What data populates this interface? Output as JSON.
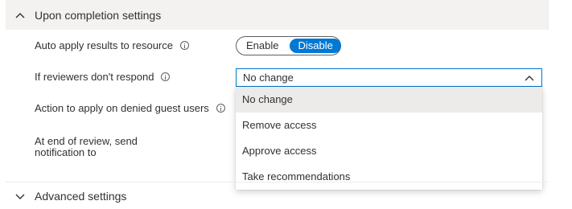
{
  "completion_section": {
    "title": "Upon completion settings",
    "expanded": true
  },
  "auto_apply": {
    "label": "Auto apply results to resource",
    "options": [
      "Enable",
      "Disable"
    ],
    "selected": "Disable"
  },
  "no_response": {
    "label": "If reviewers don't respond",
    "value": "No change",
    "options": [
      "No change",
      "Remove access",
      "Approve access",
      "Take recommendations"
    ]
  },
  "denied_guests": {
    "label": "Action to apply on denied guest users"
  },
  "notification": {
    "label_line1": "At end of review, send",
    "label_line2": "notification to"
  },
  "advanced_section": {
    "title": "Advanced settings",
    "expanded": false
  },
  "colors": {
    "accent": "#0078d4",
    "header_bg": "#f3f2f1",
    "selected_item_bg": "#edebe9"
  }
}
